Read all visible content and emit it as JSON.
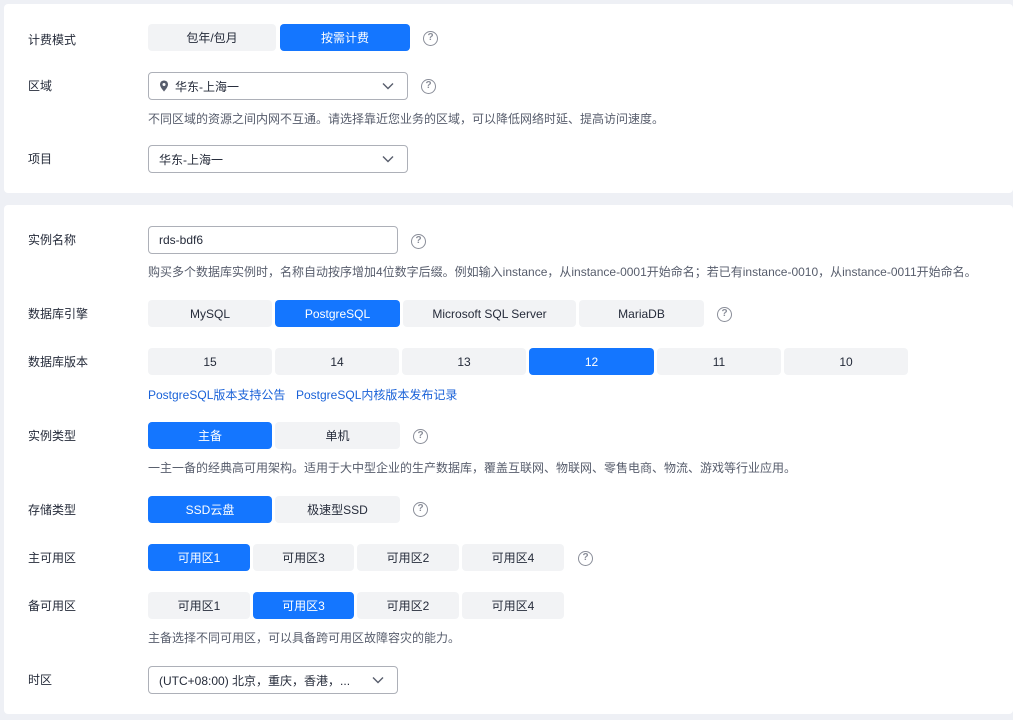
{
  "billing": {
    "label": "计费模式",
    "options": [
      "包年/包月",
      "按需计费"
    ],
    "selected": 1
  },
  "region": {
    "label": "区域",
    "value": "华东-上海一",
    "hint": "不同区域的资源之间内网不互通。请选择靠近您业务的区域，可以降低网络时延、提高访问速度。"
  },
  "project": {
    "label": "项目",
    "value": "华东-上海一"
  },
  "instance_name": {
    "label": "实例名称",
    "value": "rds-bdf6",
    "hint": "购买多个数据库实例时，名称自动按序增加4位数字后缀。例如输入instance，从instance-0001开始命名；若已有instance-0010，从instance-0011开始命名。"
  },
  "engine": {
    "label": "数据库引擎",
    "options": [
      "MySQL",
      "PostgreSQL",
      "Microsoft SQL Server",
      "MariaDB"
    ],
    "selected": 1
  },
  "version": {
    "label": "数据库版本",
    "options": [
      "15",
      "14",
      "13",
      "12",
      "11",
      "10"
    ],
    "selected": 3,
    "links": [
      "PostgreSQL版本支持公告",
      "PostgreSQL内核版本发布记录"
    ]
  },
  "instance_type": {
    "label": "实例类型",
    "options": [
      "主备",
      "单机"
    ],
    "selected": 0,
    "hint": "一主一备的经典高可用架构。适用于大中型企业的生产数据库，覆盖互联网、物联网、零售电商、物流、游戏等行业应用。"
  },
  "storage_type": {
    "label": "存储类型",
    "options": [
      "SSD云盘",
      "极速型SSD"
    ],
    "selected": 0
  },
  "primary_az": {
    "label": "主可用区",
    "options": [
      "可用区1",
      "可用区3",
      "可用区2",
      "可用区4"
    ],
    "selected": 0
  },
  "standby_az": {
    "label": "备可用区",
    "options": [
      "可用区1",
      "可用区3",
      "可用区2",
      "可用区4"
    ],
    "selected": 1,
    "hint": "主备选择不同可用区，可以具备跨可用区故障容灾的能力。"
  },
  "timezone": {
    "label": "时区",
    "value": "(UTC+08:00) 北京，重庆，香港，..."
  },
  "help_glyph": "?",
  "colors": {
    "accent": "#1476ff",
    "segment_bg": "#f2f3f5",
    "link": "#1a62d8",
    "page_bg": "#eef0f5"
  }
}
